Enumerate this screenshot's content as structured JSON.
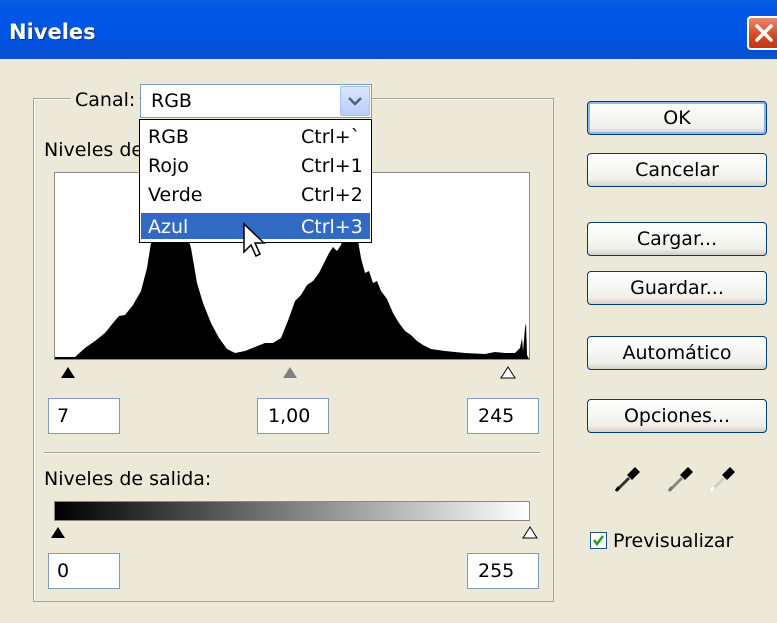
{
  "window": {
    "title": "Niveles"
  },
  "channel": {
    "label": "Canal:",
    "selected": "RGB",
    "options": [
      {
        "label": "RGB",
        "shortcut": "Ctrl+`"
      },
      {
        "label": "Rojo",
        "shortcut": "Ctrl+1"
      },
      {
        "label": "Verde",
        "shortcut": "Ctrl+2"
      },
      {
        "label": "Azul",
        "shortcut": "Ctrl+3",
        "highlighted": true
      }
    ]
  },
  "input_levels": {
    "label": "Niveles de",
    "black": "7",
    "gamma": "1,00",
    "white": "245"
  },
  "output_levels": {
    "label": "Niveles de salida:",
    "black": "0",
    "white": "255"
  },
  "buttons": {
    "ok": "OK",
    "cancel": "Cancelar",
    "load": "Cargar...",
    "save": "Guardar...",
    "auto": "Automático",
    "options": "Opciones..."
  },
  "preview": {
    "label": "Previsualizar",
    "checked": true
  },
  "icons": [
    "close-icon",
    "chevron-down-icon",
    "black-eyedropper-icon",
    "gray-eyedropper-icon",
    "white-eyedropper-icon",
    "checkmark-icon",
    "mouse-pointer-icon"
  ],
  "colors": {
    "titlebar": "#0054e3",
    "highlight": "#316ac5",
    "close": "#d5461f",
    "dialog": "#ece9d8"
  }
}
